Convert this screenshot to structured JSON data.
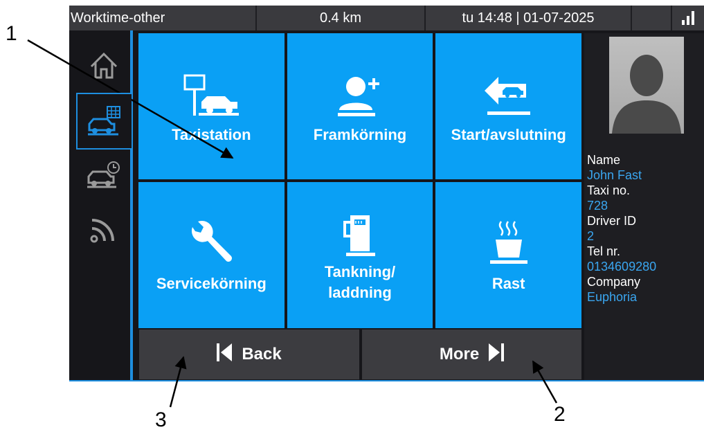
{
  "status_bar": {
    "status": "Worktime-other",
    "distance": "0.4 km",
    "datetime": "tu 14:48 | 01-07-2025"
  },
  "side_nav": [
    {
      "icon": "home-icon"
    },
    {
      "icon": "taxi-meter-icon",
      "active": true
    },
    {
      "icon": "car-clock-icon"
    },
    {
      "icon": "signal-arc-icon"
    }
  ],
  "tiles": [
    {
      "label": "Taxistation",
      "icon": "taxi-station-icon"
    },
    {
      "label": "Framkörning",
      "icon": "add-person-icon"
    },
    {
      "label": "Start/avslutning",
      "icon": "car-arrow-icon"
    },
    {
      "label": "Servicekörning",
      "icon": "wrench-icon"
    },
    {
      "label_line1": "Tankning/",
      "label_line2": "laddning",
      "icon": "fuel-pump-icon"
    },
    {
      "label": "Rast",
      "icon": "coffee-cup-icon"
    }
  ],
  "buttons": {
    "back": "Back",
    "more": "More"
  },
  "driver": {
    "name_label": "Name",
    "name": "John Fast",
    "taxi_label": "Taxi no.",
    "taxi": "728",
    "driver_id_label": "Driver ID",
    "driver_id": "2",
    "tel_label": "Tel nr.",
    "tel": "0134609280",
    "company_label": "Company",
    "company": "Euphoria"
  },
  "callouts": [
    "1",
    "2",
    "3"
  ],
  "colors": {
    "tile_blue": "#0aa0f5",
    "accent_blue": "#1e8fe0",
    "value_blue": "#3aa6f0",
    "dark_bg": "#16161a",
    "status_bar": "#3a3a3e"
  }
}
